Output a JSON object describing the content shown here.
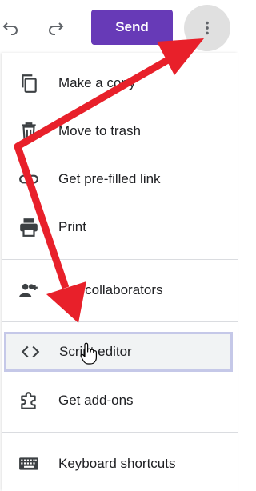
{
  "toolbar": {
    "undo_icon": "undo-icon",
    "redo_icon": "redo-icon",
    "send_label": "Send",
    "more_icon": "more-vert-icon"
  },
  "menu": {
    "items": [
      {
        "label": "Make a copy",
        "icon": "copy-icon"
      },
      {
        "label": "Move to trash",
        "icon": "trash-icon"
      },
      {
        "label": "Get pre-filled link",
        "icon": "link-icon"
      },
      {
        "label": "Print",
        "icon": "print-icon"
      },
      {
        "label": "d collaborators",
        "icon": "add-people-icon"
      },
      {
        "label": "Script editor",
        "icon": "code-icon"
      },
      {
        "label": "Get add-ons",
        "icon": "puzzle-icon"
      },
      {
        "label": "Keyboard shortcuts",
        "icon": "keyboard-icon"
      }
    ]
  },
  "colors": {
    "send_button": "#673ab7",
    "annotation_arrow": "#e8202a",
    "highlight_border": "#c5c8e8",
    "more_button_bg": "#e0e0e0"
  }
}
